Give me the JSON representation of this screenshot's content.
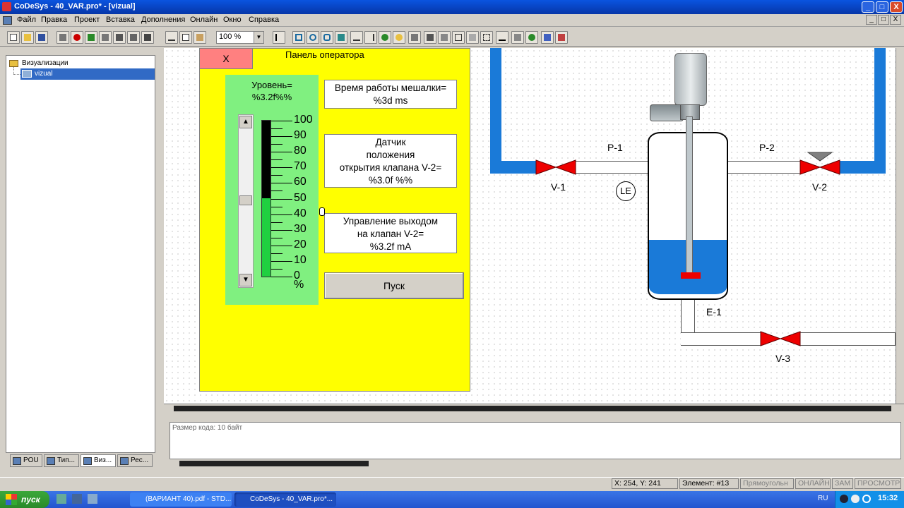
{
  "window": {
    "title": "CoDeSys - 40_VAR.pro* - [vizual]",
    "controls": [
      "_",
      "□",
      "X"
    ]
  },
  "menu": [
    "Файл",
    "Правка",
    "Проект",
    "Вставка",
    "Дополнения",
    "Онлайн",
    "Окно",
    "Справка"
  ],
  "toolbar": {
    "zoom": "100 %"
  },
  "tree": {
    "root": "Визуализации",
    "child": "vizual"
  },
  "left_tabs": [
    "POU",
    "Тип...",
    "Виз...",
    "Рес..."
  ],
  "panel": {
    "close_label": "X",
    "title": "Панель оператора",
    "level_title": "Уровень=\n%3.2f%%",
    "level_value_pct": 50,
    "scale": [
      "100",
      "90",
      "80",
      "70",
      "60",
      "50",
      "40",
      "30",
      "20",
      "10",
      "0"
    ],
    "scale_unit": "%",
    "mixer_time": "Время работы мешалки=\n%3d ms",
    "valve_sensor": "Датчик\nположения\nоткрытия клапана V-2=\n%3.0f %%",
    "valve_control": "Управление выходом\nна клапан V-2=\n%3.2f mA",
    "start_label": "Пуск"
  },
  "diagram": {
    "p1": "P-1",
    "p2": "P-2",
    "v1": "V-1",
    "v2": "V-2",
    "v3": "V-3",
    "le": "LE",
    "e1": "E-1",
    "water_level_pct": 33,
    "colors": {
      "water": "#1a7ad8",
      "valve": "#e00000"
    }
  },
  "output": {
    "text": "Размер кода: 10 байт"
  },
  "status": {
    "coords": "X:   254, Y:   241",
    "element": "Элемент: #13",
    "mode": "Прямоугольн",
    "online": "ОНЛАЙН",
    "zam": "ЗАМ",
    "view": "ПРОСМОТР"
  },
  "taskbar": {
    "start": "пуск",
    "tasks": [
      "(ВАРИАНТ 40).pdf - STD...",
      "CoDeSys - 40_VAR.pro*..."
    ],
    "lang": "RU",
    "clock": "15:32"
  }
}
